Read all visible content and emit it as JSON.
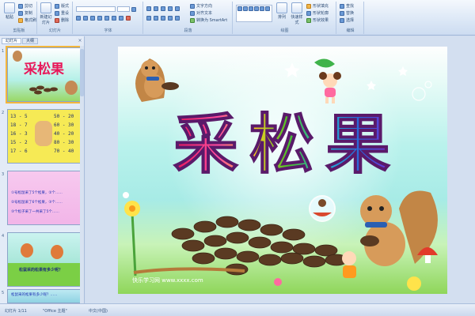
{
  "ribbon": {
    "groups": [
      {
        "label": "剪贴板"
      },
      {
        "label": "幻灯片"
      },
      {
        "label": "字体"
      },
      {
        "label": "段落"
      },
      {
        "label": "绘图"
      },
      {
        "label": "编辑"
      }
    ],
    "clipboard": {
      "paste": "粘贴",
      "cut": "剪切",
      "copy": "复制",
      "format": "格式刷"
    },
    "slides": {
      "new_slide": "新建幻灯片",
      "layout": "版式",
      "reset": "重设",
      "delete": "删除"
    },
    "font": {
      "name": "",
      "size": ""
    },
    "paragraph": {
      "text_direction": "文字方向",
      "align_text": "对齐文本",
      "smartart": "转换为 SmartArt"
    },
    "drawing": {
      "arrange": "排列",
      "quick_styles": "快速样式"
    },
    "drawing_fx": {
      "shape_fill": "形状填充",
      "shape_outline": "形状轮廓",
      "shape_effects": "形状效果"
    },
    "editing": {
      "find": "查找",
      "replace": "替换",
      "select": "选择"
    }
  },
  "pane": {
    "tabs": [
      "幻灯片",
      "大纲"
    ],
    "close": "×",
    "thumbnails": [
      {
        "num": "1",
        "title": "采松果"
      },
      {
        "num": "2",
        "lines": [
          "13 - 5",
          "18 - 7",
          "16 - 3",
          "15 - 2",
          "17 - 6"
        ],
        "right": [
          "50 - 20",
          "60 - 30",
          "40 - 20",
          "80 - 30",
          "70 - 40"
        ]
      },
      {
        "num": "3",
        "lines": [
          "①号松鼠采了5个松果，②个……",
          "②号松鼠采了6个松果，③个……",
          "③个松子采了一共采了5个……"
        ]
      },
      {
        "num": "4",
        "caption": "松鼠采的松果有多少呢？"
      },
      {
        "num": "5",
        "caption": "松鼠采的松果有多少呢？……"
      }
    ]
  },
  "slide": {
    "title": "采松果",
    "footer": "快乐学习网 www.xxxx.com"
  },
  "status": {
    "slide_info": "幻灯片 1/11",
    "theme": "\"Office 主题\"",
    "language": "中文(中国)"
  },
  "colors": {
    "title_red": "#e8185a",
    "title_green": "#4fbf2a",
    "title_blue": "#2c62d8",
    "title_purple": "#8b1fd1",
    "pinecone": "#5a3a22",
    "accent_select": "#f3b63c"
  }
}
